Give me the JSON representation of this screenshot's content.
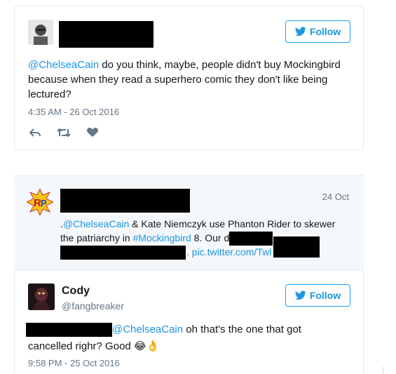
{
  "tweet1": {
    "follow_label": "Follow",
    "mention": "@ChelseaCain",
    "text_rest": " do you think, maybe, people didn't buy Mockingbird because when they read a superhero comic they don't like being lectured?",
    "timestamp": "4:35 AM - 26 Oct 2016",
    "actions": [
      "reply-icon",
      "retweet-icon",
      "like-icon"
    ]
  },
  "quoted": {
    "date": "24 Oct",
    "line1_prefix": ".",
    "line1_mention": "@ChelseaCain",
    "line1_rest": " & Kate Niemczyk use Phanton Rider to skewer",
    "line2_start": "the patriarchy in ",
    "line2_hashtag": "#Mockingbird",
    "line2_rest": " 8. Our discussion: ",
    "line3_link": ". pic.twitter.com/Twl"
  },
  "tweet2": {
    "name": "Cody",
    "handle": "@fangbreaker",
    "follow_label": "Follow",
    "mention": "@ChelseaCain",
    "text_rest": " oh that's the one that got",
    "line2": "cancelled righr? Good ",
    "emoji": "😂👌",
    "timestamp": "9:58 PM - 25 Oct 2016"
  },
  "colors": {
    "accent": "#1b95e0",
    "muted": "#657786",
    "border": "#e1e8ed",
    "quote_bg": "#f5f8fa"
  }
}
